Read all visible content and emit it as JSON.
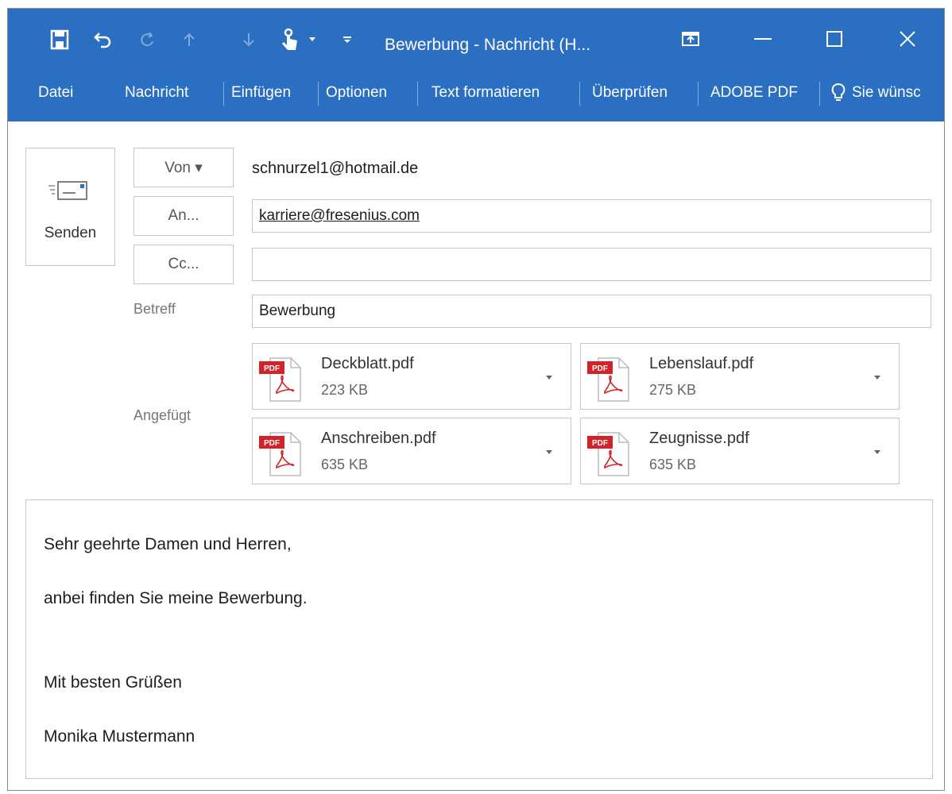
{
  "window": {
    "title": "Bewerbung - Nachricht (H...",
    "accent_color": "#2b6fc2"
  },
  "quick_access": {
    "icons": [
      "save-icon",
      "undo-icon",
      "redo-icon",
      "arrow-up-icon",
      "arrow-down-icon",
      "touch-mode-icon",
      "customize-icon"
    ]
  },
  "ribbon": {
    "tabs": [
      "Datei",
      "Nachricht",
      "Einfügen",
      "Optionen",
      "Text formatieren",
      "Überprüfen",
      "ADOBE PDF",
      "Sie wünsc"
    ]
  },
  "compose": {
    "send_label": "Senden",
    "from_button": "Von ▾",
    "from_value": "schnurzel1@hotmail.de",
    "to_button": "An...",
    "to_value": "karriere@fresenius.com",
    "cc_button": "Cc...",
    "cc_value": "",
    "subject_label": "Betreff",
    "subject_value": "Bewerbung",
    "attached_label": "Angefügt"
  },
  "attachments": [
    {
      "name": "Deckblatt.pdf",
      "size": "223 KB",
      "icon": "pdf-icon"
    },
    {
      "name": "Lebenslauf.pdf",
      "size": "275 KB",
      "icon": "pdf-icon"
    },
    {
      "name": "Anschreiben.pdf",
      "size": "635 KB",
      "icon": "pdf-icon"
    },
    {
      "name": "Zeugnisse.pdf",
      "size": "635 KB",
      "icon": "pdf-icon"
    }
  ],
  "body": {
    "lines": [
      "Sehr geehrte Damen und Herren,",
      "anbei finden Sie meine Bewerbung.",
      "Mit besten Grüßen",
      "Monika Mustermann"
    ]
  }
}
